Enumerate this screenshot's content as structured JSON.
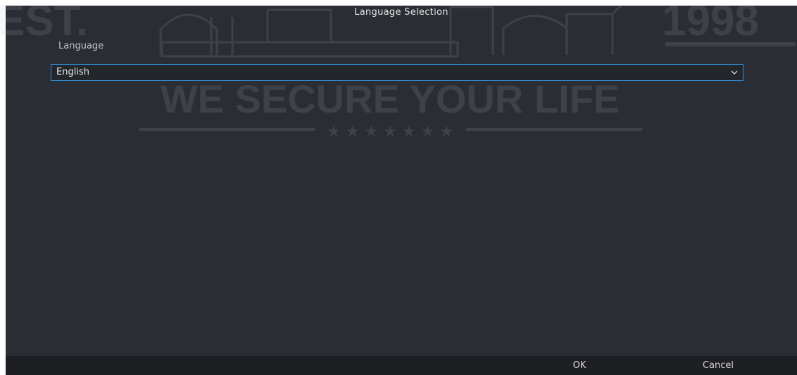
{
  "dialog": {
    "title": "Language Selection",
    "field_label": "Language",
    "language_select": {
      "value": "English"
    }
  },
  "footer": {
    "ok_label": "OK",
    "cancel_label": "Cancel"
  },
  "watermark": {
    "left_text": "EST.",
    "right_text": "1998",
    "tagline": "WE SECURE YOUR LIFE",
    "stars": "★ ★ ★ ★ ★ ★ ★"
  },
  "colors": {
    "dialog_bg": "#2a2d33",
    "footer_bg": "#1d1f23",
    "select_border": "#2f8fd8",
    "text": "#e6e6e6"
  }
}
